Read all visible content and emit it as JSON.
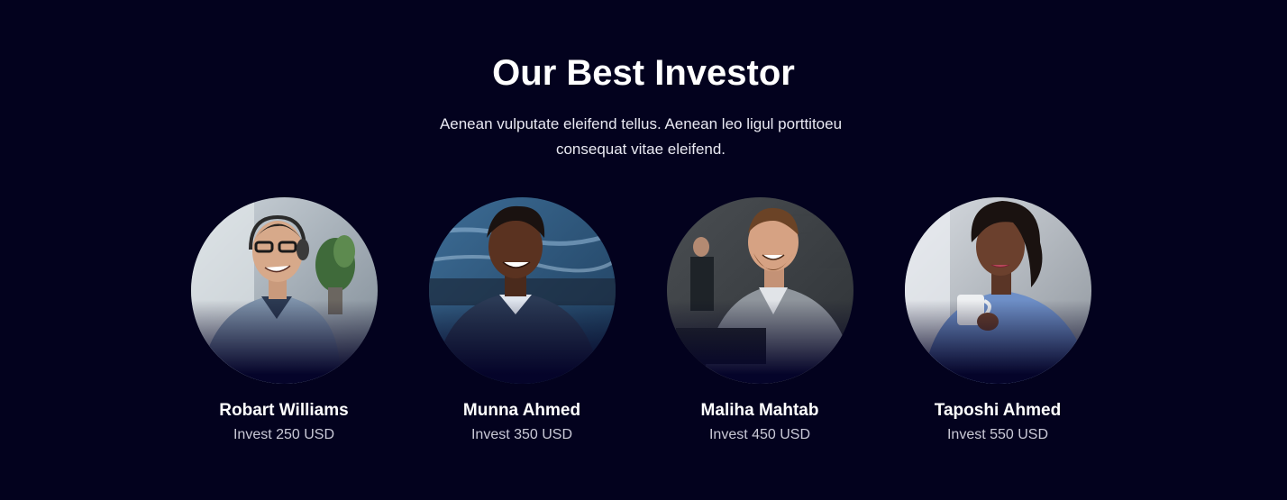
{
  "section": {
    "title": "Our Best Investor",
    "subtitle": "Aenean vulputate eleifend tellus. Aenean leo ligul porttitoeu consequat vitae eleifend."
  },
  "investors": [
    {
      "name": "Robart Williams",
      "invest": "Invest 250 USD",
      "photo": "man-with-headset-photo"
    },
    {
      "name": "Munna Ahmed",
      "invest": "Invest 350 USD",
      "photo": "smiling-man-photo"
    },
    {
      "name": "Maliha Mahtab",
      "invest": "Invest 450 USD",
      "photo": "bearded-man-office-photo"
    },
    {
      "name": "Taposhi Ahmed",
      "invest": "Invest 550 USD",
      "photo": "woman-with-coffee-photo"
    }
  ],
  "colors": {
    "background": "#03021e",
    "title": "#ffffff",
    "subtitle": "#e9e9f2",
    "invest_text": "#c9c9d6"
  }
}
